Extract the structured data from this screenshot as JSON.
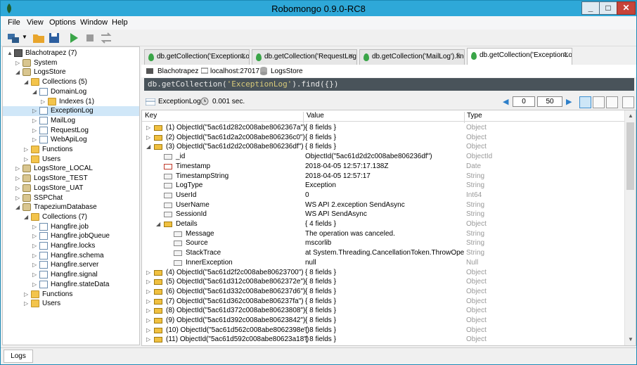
{
  "window": {
    "title": "Robomongo 0.9.0-RC8"
  },
  "menu": [
    "File",
    "View",
    "Options",
    "Window",
    "Help"
  ],
  "sidebar": {
    "items": [
      {
        "label": "Blachotrapez (7)",
        "icon": "server-icon",
        "exp": "▲"
      },
      {
        "label": "System",
        "icon": "database-icon",
        "exp": "▷"
      },
      {
        "label": "LogsStore",
        "icon": "database-icon",
        "exp": "◢"
      },
      {
        "label": "Collections (5)",
        "icon": "folder-icon",
        "exp": "◢"
      },
      {
        "label": "DomainLog",
        "icon": "collection-icon",
        "exp": "◢"
      },
      {
        "label": "Indexes (1)",
        "icon": "folder-icon",
        "exp": "▷"
      },
      {
        "label": "ExceptionLog",
        "icon": "collection-icon",
        "exp": "▷",
        "selected": true
      },
      {
        "label": "MailLog",
        "icon": "collection-icon",
        "exp": "▷"
      },
      {
        "label": "RequestLog",
        "icon": "collection-icon",
        "exp": "▷"
      },
      {
        "label": "WebApiLog",
        "icon": "collection-icon",
        "exp": "▷"
      },
      {
        "label": "Functions",
        "icon": "folder-icon",
        "exp": "▷"
      },
      {
        "label": "Users",
        "icon": "folder-icon",
        "exp": "▷"
      },
      {
        "label": "LogsStore_LOCAL",
        "icon": "database-icon",
        "exp": "▷"
      },
      {
        "label": "LogsStore_TEST",
        "icon": "database-icon",
        "exp": "▷"
      },
      {
        "label": "LogsStore_UAT",
        "icon": "database-icon",
        "exp": "▷"
      },
      {
        "label": "SSPChat",
        "icon": "database-icon",
        "exp": "▷"
      },
      {
        "label": "TrapeziumDatabase",
        "icon": "database-icon",
        "exp": "◢"
      },
      {
        "label": "Collections (7)",
        "icon": "folder-icon",
        "exp": "◢"
      },
      {
        "label": "Hangfire.job",
        "icon": "collection-icon",
        "exp": "▷"
      },
      {
        "label": "Hangfire.jobQueue",
        "icon": "collection-icon",
        "exp": "▷"
      },
      {
        "label": "Hangfire.locks",
        "icon": "collection-icon",
        "exp": "▷"
      },
      {
        "label": "Hangfire.schema",
        "icon": "collection-icon",
        "exp": "▷"
      },
      {
        "label": "Hangfire.server",
        "icon": "collection-icon",
        "exp": "▷"
      },
      {
        "label": "Hangfire.signal",
        "icon": "collection-icon",
        "exp": "▷"
      },
      {
        "label": "Hangfire.stateData",
        "icon": "collection-icon",
        "exp": "▷"
      },
      {
        "label": "Functions",
        "icon": "folder-icon",
        "exp": "▷"
      },
      {
        "label": "Users",
        "icon": "folder-icon",
        "exp": "▷"
      }
    ]
  },
  "tabs": [
    {
      "label": "db.getCollection('ExceptionLog'...",
      "close": "✕"
    },
    {
      "label": "db.getCollection('RequestLog')...",
      "close": "✕"
    },
    {
      "label": "db.getCollection('MailLog').find...",
      "close": "✕"
    },
    {
      "label": "db.getCollection('ExceptionLog')...",
      "close": "✕",
      "active": true
    }
  ],
  "connection": {
    "server": "Blachotrapez",
    "host": "localhost:27017",
    "database": "LogsStore"
  },
  "query": {
    "prefix": "db.getCollection(",
    "string": "'ExceptionLog'",
    "suffix": ").find({})"
  },
  "results": {
    "collection": "ExceptionLog",
    "time": "0.001 sec.",
    "skip": "0",
    "limit": "50",
    "columns": {
      "key": "Key",
      "value": "Value",
      "type": "Type"
    },
    "rows": [
      {
        "key": "(1) ObjectId(\"5ac61d282c008abe8062367a\")",
        "value": "{ 8 fields }",
        "type": "Object",
        "level": 0,
        "icon": "object",
        "exp": "▷"
      },
      {
        "key": "(2) ObjectId(\"5ac61d2a2c008abe806236c0\")",
        "value": "{ 8 fields }",
        "type": "Object",
        "level": 0,
        "icon": "object",
        "exp": "▷"
      },
      {
        "key": "(3) ObjectId(\"5ac61d2d2c008abe806236df\")",
        "value": "{ 8 fields }",
        "type": "Object",
        "level": 0,
        "icon": "object",
        "exp": "◢"
      },
      {
        "key": "_id",
        "value": "ObjectId(\"5ac61d2d2c008abe806236df\")",
        "type": "ObjectId",
        "level": 1,
        "icon": "field"
      },
      {
        "key": "Timestamp",
        "value": "2018-04-05 12:57:17.138Z",
        "type": "Date",
        "level": 1,
        "icon": "date"
      },
      {
        "key": "TimestampString",
        "value": "2018-04-05 12:57:17",
        "type": "String",
        "level": 1,
        "icon": "field"
      },
      {
        "key": "LogType",
        "value": "Exception",
        "type": "String",
        "level": 1,
        "icon": "field"
      },
      {
        "key": "UserId",
        "value": "0",
        "type": "Int64",
        "level": 1,
        "icon": "field"
      },
      {
        "key": "UserName",
        "value": "WS API 2.exception SendAsync",
        "type": "String",
        "level": 1,
        "icon": "field"
      },
      {
        "key": "SessionId",
        "value": "WS API SendAsync",
        "type": "String",
        "level": 1,
        "icon": "field"
      },
      {
        "key": "Details",
        "value": "{ 4 fields }",
        "type": "Object",
        "level": 1,
        "icon": "object",
        "exp": "◢"
      },
      {
        "key": "Message",
        "value": "The operation was canceled.",
        "type": "String",
        "level": 2,
        "icon": "field"
      },
      {
        "key": "Source",
        "value": "mscorlib",
        "type": "String",
        "level": 2,
        "icon": "field"
      },
      {
        "key": "StackTrace",
        "value": "at System.Threading.CancellationToken.ThrowOperat...",
        "type": "String",
        "level": 2,
        "icon": "field"
      },
      {
        "key": "InnerException",
        "value": "null",
        "type": "Null",
        "level": 2,
        "icon": "null"
      },
      {
        "key": "(4) ObjectId(\"5ac61d2f2c008abe80623700\")",
        "value": "{ 8 fields }",
        "type": "Object",
        "level": 0,
        "icon": "object",
        "exp": "▷"
      },
      {
        "key": "(5) ObjectId(\"5ac61d312c008abe8062372e\")",
        "value": "{ 8 fields }",
        "type": "Object",
        "level": 0,
        "icon": "object",
        "exp": "▷"
      },
      {
        "key": "(6) ObjectId(\"5ac61d332c008abe806237d6\")",
        "value": "{ 8 fields }",
        "type": "Object",
        "level": 0,
        "icon": "object",
        "exp": "▷"
      },
      {
        "key": "(7) ObjectId(\"5ac61d362c008abe806237fa\")",
        "value": "{ 8 fields }",
        "type": "Object",
        "level": 0,
        "icon": "object",
        "exp": "▷"
      },
      {
        "key": "(8) ObjectId(\"5ac61d372c008abe80623808\")",
        "value": "{ 8 fields }",
        "type": "Object",
        "level": 0,
        "icon": "object",
        "exp": "▷"
      },
      {
        "key": "(9) ObjectId(\"5ac61d392c008abe80623842\")",
        "value": "{ 8 fields }",
        "type": "Object",
        "level": 0,
        "icon": "object",
        "exp": "▷"
      },
      {
        "key": "(10) ObjectId(\"5ac61d562c008abe8062398e\")",
        "value": "{ 8 fields }",
        "type": "Object",
        "level": 0,
        "icon": "object",
        "exp": "▷"
      },
      {
        "key": "(11) ObjectId(\"5ac61d592c008abe80623a18\")",
        "value": "{ 8 fields }",
        "type": "Object",
        "level": 0,
        "icon": "object",
        "exp": "▷"
      }
    ]
  },
  "statusbar": {
    "logs_tab": "Logs"
  },
  "colors": {
    "titlebar": "#2ea8d8",
    "query_bg": "#49535a",
    "query_string": "#d7c97a",
    "selection": "#d0e7f8"
  }
}
